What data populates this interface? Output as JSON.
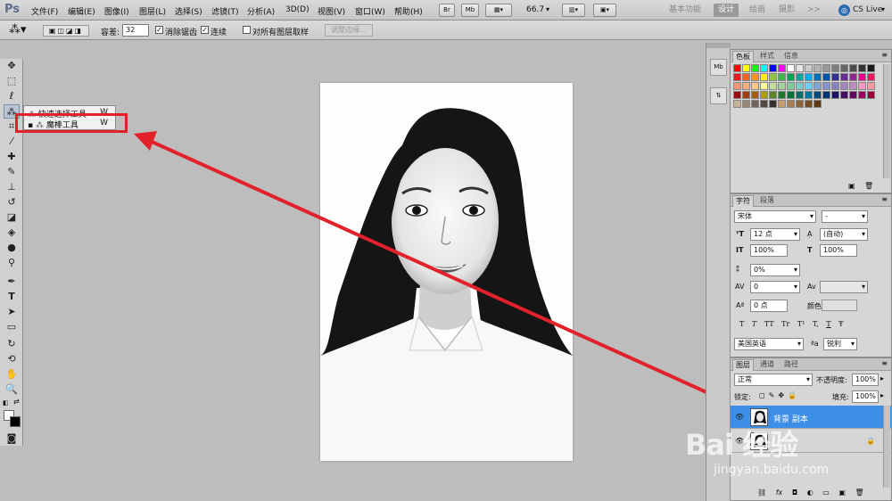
{
  "app": {
    "logo": "Ps"
  },
  "menu": [
    "文件(F)",
    "编辑(E)",
    "图像(I)",
    "图层(L)",
    "选择(S)",
    "滤镜(T)",
    "分析(A)",
    "3D(D)",
    "视图(V)",
    "窗口(W)",
    "帮助(H)"
  ],
  "menubar_tools": {
    "br": "Br",
    "mb": "Mb",
    "zoom": "66.7"
  },
  "workspaces": {
    "essentials": "基本功能",
    "design": "设计",
    "painting": "绘画",
    "photography": "摄影",
    "more": ">>",
    "cslive": "CS Live"
  },
  "options": {
    "tolerance_label": "容差:",
    "tolerance_value": "32",
    "anti_alias": "消除锯齿",
    "contiguous": "连续",
    "sample_all": "对所有图层取样",
    "refine_edge": "调整边缘..."
  },
  "flyout": {
    "items": [
      {
        "label": "快速选择工具",
        "shortcut": "W"
      },
      {
        "label": "魔棒工具",
        "shortcut": "W"
      }
    ]
  },
  "panels": {
    "swatches": {
      "tabs": [
        "色板",
        "样式",
        "信息"
      ]
    },
    "character": {
      "tabs": [
        "字符",
        "段落"
      ],
      "font_family": "宋体",
      "font_style": "-",
      "font_size": "12 点",
      "leading": "(自动)",
      "vertical_scale": "100%",
      "horizontal_scale": "100%",
      "tracking_ratio": "0%",
      "kerning": "0",
      "tracking": "",
      "baseline_shift": "0 点",
      "color_label": "颜色:",
      "type_buttons": [
        "T",
        "T",
        "TT",
        "Tr",
        "T¹",
        "T,",
        "T",
        "Ŧ"
      ],
      "language": "美国英语",
      "antialias_label": "ªa",
      "antialias_method": "锐利"
    },
    "layers": {
      "tabs": [
        "图层",
        "通道",
        "路径"
      ],
      "blend_mode": "正常",
      "opacity_label": "不透明度:",
      "opacity": "100%",
      "lock_label": "锁定:",
      "fill_label": "填充:",
      "fill": "100%",
      "items": [
        {
          "name": "背景 副本",
          "selected": true
        },
        {
          "name": "",
          "selected": false
        }
      ],
      "footer_icons": [
        "link-icon",
        "fx-icon",
        "mask-icon",
        "adjustment-icon",
        "group-icon",
        "new-layer-icon",
        "trash-icon"
      ],
      "footer_glyphs": [
        "⛓",
        "fx",
        "◘",
        "◐",
        "▭",
        "▣",
        "🗑"
      ]
    }
  },
  "watermark": {
    "text": "Bai 经验",
    "url": "jingyan.baidu.com"
  },
  "annotation_color": "#e2222b",
  "selected_color": "#3d8ee6"
}
